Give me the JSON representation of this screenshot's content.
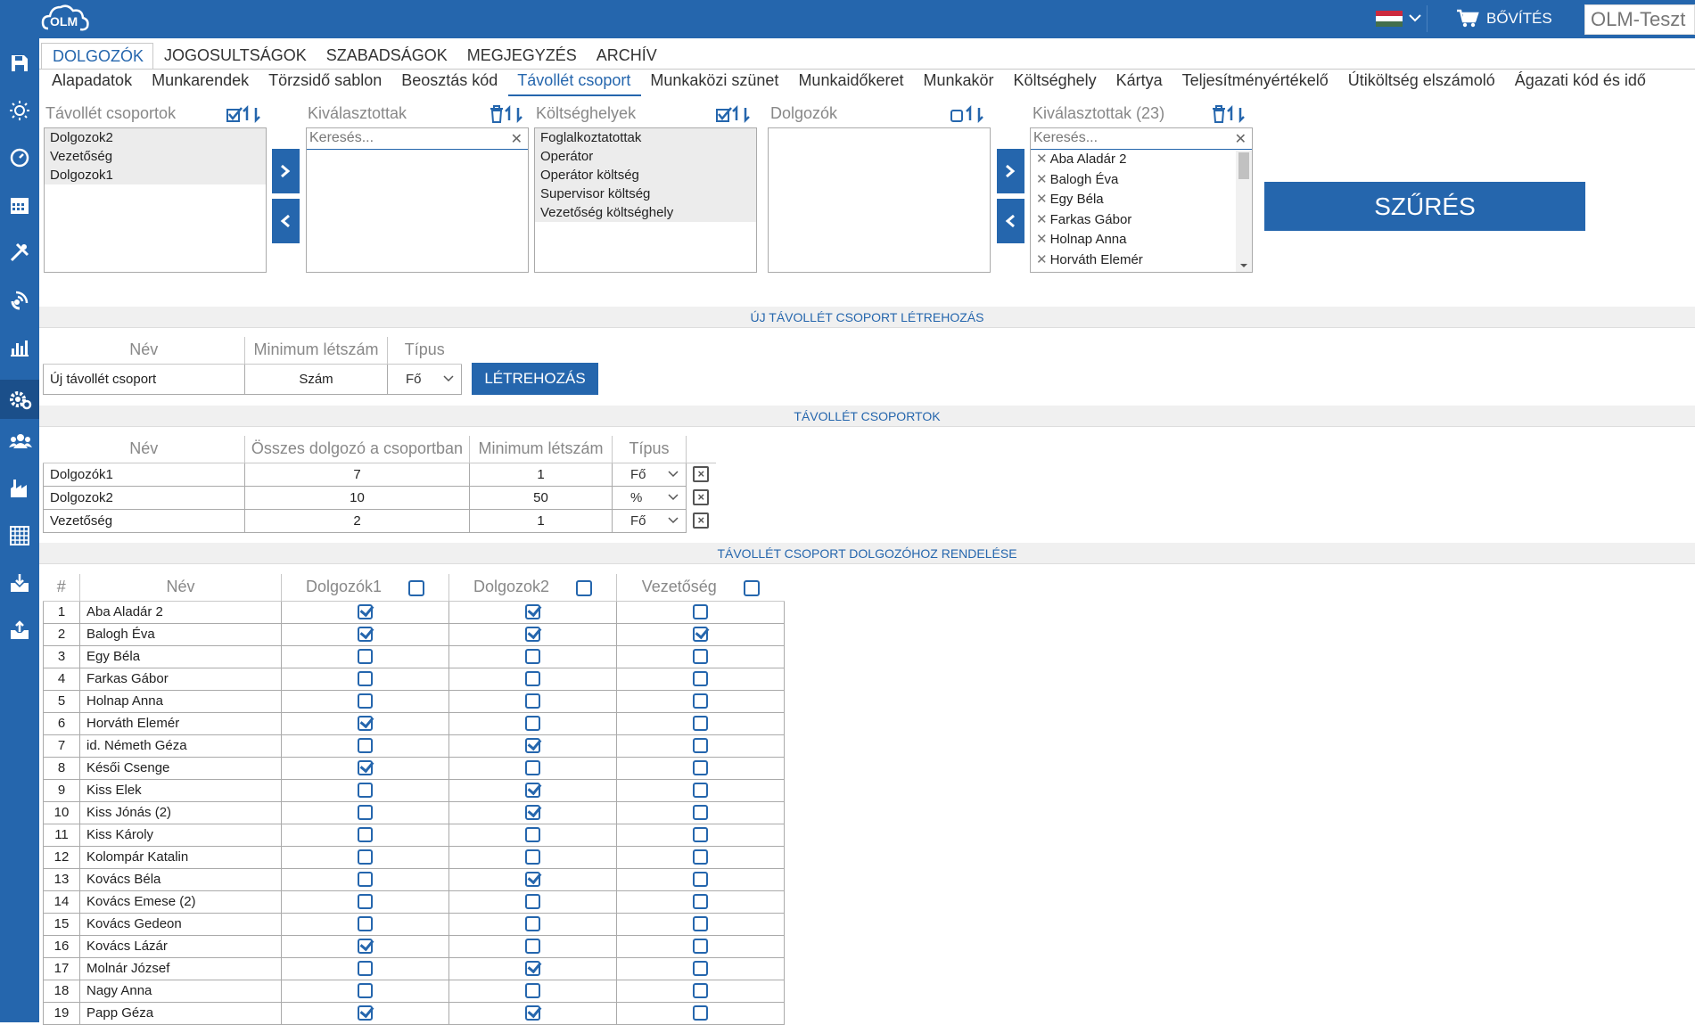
{
  "topbar": {
    "logo_text": "OLM",
    "expand_label": "BŐVÍTÉS",
    "user_box": "OLM-Teszt",
    "flag_colors": [
      "#cd2a3e",
      "#ffffff",
      "#436f4d"
    ]
  },
  "sidebar": {
    "icons": [
      "save-icon",
      "sun-icon",
      "dashboard-icon",
      "calendar-icon",
      "tools-icon",
      "satellite-icon",
      "bar-chart-icon",
      "settings-icon",
      "users-icon",
      "factory-icon",
      "grid-icon",
      "download-icon",
      "upload-icon"
    ],
    "active": "settings-icon"
  },
  "tabs_main": [
    "DOLGOZÓK",
    "JOGOSULTSÁGOK",
    "SZABADSÁGOK",
    "MEGJEGYZÉS",
    "ARCHÍV"
  ],
  "tabs_sub": [
    "Alapadatok",
    "Munkarendek",
    "Törzsidő sablon",
    "Beosztás kód",
    "Távollét csoport",
    "Munkaközi szünet",
    "Munkaidőkeret",
    "Munkakör",
    "Költséghely",
    "Kártya",
    "Teljesítményértékelő",
    "Útiköltség elszámoló",
    "Ágazati kód és idő"
  ],
  "filters": {
    "groups_label": "Távollét csoportok",
    "groups": [
      "Dolgozok2",
      "Vezetőség",
      "Dolgozok1"
    ],
    "selected_label": "Kiválasztottak",
    "search_placeholder": "Keresés...",
    "cost_label": "Költséghelyek",
    "costs": [
      "Foglalkoztatottak",
      "Operátor",
      "Operátor költség",
      "Supervisor költség",
      "Vezetőség költséghely"
    ],
    "employees_label": "Dolgozók",
    "selected2_label": "Kiválasztottak (23)",
    "selected_employees": [
      "Aba Aladár 2",
      "Balogh Éva",
      "Egy Béla",
      "Farkas Gábor",
      "Holnap Anna",
      "Horváth Elemér"
    ],
    "filter_button": "SZŰRÉS"
  },
  "create_section": {
    "title": "ÚJ TÁVOLLÉT CSOPORT LÉTREHOZÁS",
    "headers": [
      "Név",
      "Minimum létszám",
      "Típus"
    ],
    "name_value": "Új távollét csoport",
    "min_value": "Szám",
    "type_value": "Fő",
    "create_button": "LÉTREHOZÁS"
  },
  "groups_section": {
    "title": "TÁVOLLÉT CSOPORTOK",
    "headers": [
      "Név",
      "Összes dolgozó a csoportban",
      "Minimum létszám",
      "Típus"
    ],
    "rows": [
      {
        "name": "Dolgozók1",
        "total": "7",
        "min": "1",
        "type": "Fő"
      },
      {
        "name": "Dolgozok2",
        "total": "10",
        "min": "50",
        "type": "%"
      },
      {
        "name": "Vezetőség",
        "total": "2",
        "min": "1",
        "type": "Fő"
      }
    ]
  },
  "assign_section": {
    "title": "TÁVOLLÉT CSOPORT DOLGOZÓHOZ RENDELÉSE",
    "headers": [
      "#",
      "Név",
      "Dolgozók1",
      "Dolgozok2",
      "Vezetőség"
    ],
    "rows": [
      {
        "n": "1",
        "name": "Aba Aladár 2",
        "c": [
          true,
          true,
          false
        ]
      },
      {
        "n": "2",
        "name": "Balogh Éva",
        "c": [
          true,
          true,
          true
        ]
      },
      {
        "n": "3",
        "name": "Egy Béla",
        "c": [
          false,
          false,
          false
        ]
      },
      {
        "n": "4",
        "name": "Farkas Gábor",
        "c": [
          false,
          false,
          false
        ]
      },
      {
        "n": "5",
        "name": "Holnap Anna",
        "c": [
          false,
          false,
          false
        ]
      },
      {
        "n": "6",
        "name": "Horváth Elemér",
        "c": [
          true,
          false,
          false
        ]
      },
      {
        "n": "7",
        "name": "id. Németh Géza",
        "c": [
          false,
          true,
          false
        ]
      },
      {
        "n": "8",
        "name": "Késői Csenge",
        "c": [
          true,
          false,
          false
        ]
      },
      {
        "n": "9",
        "name": "Kiss Elek",
        "c": [
          false,
          true,
          false
        ]
      },
      {
        "n": "10",
        "name": "Kiss Jónás (2)",
        "c": [
          false,
          true,
          false
        ]
      },
      {
        "n": "11",
        "name": "Kiss Károly",
        "c": [
          false,
          false,
          false
        ]
      },
      {
        "n": "12",
        "name": "Kolompár Katalin",
        "c": [
          false,
          false,
          false
        ]
      },
      {
        "n": "13",
        "name": "Kovács Béla",
        "c": [
          false,
          true,
          false
        ]
      },
      {
        "n": "14",
        "name": "Kovács Emese (2)",
        "c": [
          false,
          false,
          false
        ]
      },
      {
        "n": "15",
        "name": "Kovács Gedeon",
        "c": [
          false,
          false,
          false
        ]
      },
      {
        "n": "16",
        "name": "Kovács Lázár",
        "c": [
          true,
          false,
          false
        ]
      },
      {
        "n": "17",
        "name": "Molnár József",
        "c": [
          false,
          true,
          false
        ]
      },
      {
        "n": "18",
        "name": "Nagy Anna",
        "c": [
          false,
          false,
          false
        ]
      },
      {
        "n": "19",
        "name": "Papp Géza",
        "c": [
          true,
          true,
          false
        ]
      }
    ]
  }
}
